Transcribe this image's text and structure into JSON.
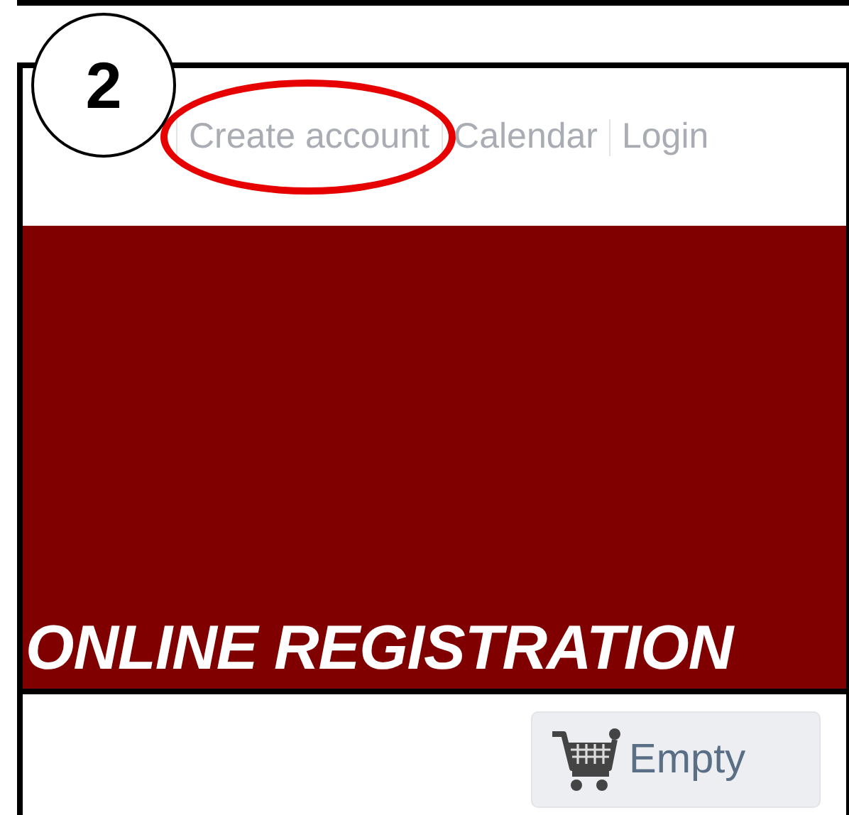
{
  "step_badge": "2",
  "nav": {
    "links": [
      {
        "label": "Create account",
        "highlighted": true
      },
      {
        "label": "Calendar",
        "highlighted": false
      },
      {
        "label": "Login",
        "highlighted": false
      }
    ]
  },
  "banner": {
    "title": "ONLINE REGISTRATION"
  },
  "cart": {
    "label": "Empty"
  }
}
